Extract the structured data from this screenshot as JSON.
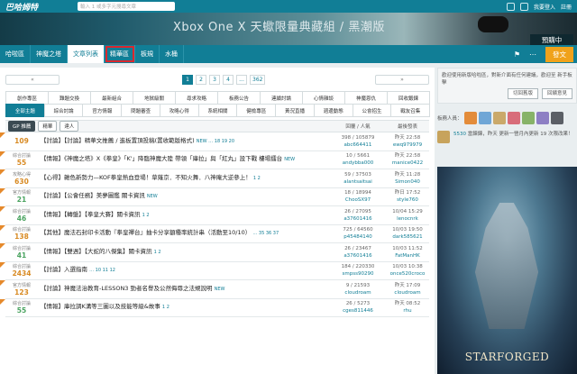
{
  "topbar": {
    "logo": "巴哈姆特",
    "search_placeholder": "輸入 1 或多字元搜尋文章",
    "user_center": "我要登入",
    "register": "註冊"
  },
  "banner": {
    "title": "Xbox One X 天蠍限量典藏組 / 黑潮版",
    "cta": "預購中"
  },
  "nav": {
    "items": [
      {
        "label": "哈啦區",
        "state": "normal"
      },
      {
        "label": "神魔之塔",
        "state": "normal"
      },
      {
        "label": "文章列表",
        "state": "active"
      },
      {
        "label": "精華區",
        "state": "boxed"
      },
      {
        "label": "板規",
        "state": "normal"
      },
      {
        "label": "水桶",
        "state": "normal"
      }
    ],
    "post_label": "發文"
  },
  "pager": {
    "prev": "«",
    "next": "»",
    "pages": [
      "1",
      "2",
      "3",
      "4",
      "...",
      "362"
    ],
    "current": "1"
  },
  "categories": [
    [
      "創作專區",
      "難題交換",
      "最新組合",
      "地獄級關",
      "尋求攻略",
      "板務公告",
      "連續討論",
      "心情雜談",
      "神魔恩仇",
      "回收鍛鍊"
    ],
    [
      "全部主題",
      "綜合討論",
      "官方情報",
      "問題審查",
      "攻略心得",
      "系統相關",
      "健檢專區",
      "黃況直播",
      "週邊動態",
      "公會招生",
      "戰友召集"
    ]
  ],
  "filter": {
    "gp": "GP 推薦",
    "tag1": "精華",
    "tag2": "達人",
    "col_reply": "回覆 / 人氣",
    "col_last": "最後發表"
  },
  "threads": [
    {
      "cat": "",
      "num": "109",
      "title": "【討論】【討論】精華文推薦 / 進板置頂投稿(置收範版格式)",
      "sub": "NEW … 18 19 20",
      "stats": "398 / 105879",
      "user": "abc664411",
      "time": "昨天 22:58",
      "last_user": "ewq979979"
    },
    {
      "cat": "綜合討論",
      "num": "55",
      "title": "【情報】《神魔之塔》X《拳皇》「K'」降臨神魔大陸 帶領「庫拉」與「紅丸」設下戰 樓場擂台",
      "sub": "NEW",
      "stats": "10 / 5661",
      "user": "andybba000",
      "time": "昨天 22:58",
      "last_user": "manice0422"
    },
    {
      "cat": "攻略心得",
      "num": "630",
      "title": "【心得】雜色新勢力—KOF拳皇熱血登場！草薙京．不知火舞．八神庵大逆參上！",
      "sub": "1 2",
      "stats": "59 / 37503",
      "user": "alantsaitsai",
      "time": "昨天 11:28",
      "last_user": "Simon040"
    },
    {
      "cat": "官方情報",
      "num": "21",
      "title": "【討論】【公會任務】美夢圖鑑 關卡資訊",
      "sub": "NEW",
      "stats": "18 / 18994",
      "user": "ChooSX97",
      "time": "昨日 17:52",
      "last_user": "style760"
    },
    {
      "cat": "綜合討論",
      "num": "46",
      "title": "【情報】【轉盤】【拳皇大賽】關卡資訊",
      "sub": "1 2",
      "stats": "26 / 27095",
      "user": "a37601416",
      "time": "10/04 15:29",
      "last_user": "lenocnrk"
    },
    {
      "cat": "綜合討論",
      "num": "138",
      "title": "【其他】魔法石封印卡活動『拳皇禪台』抽卡分享額種率統計串（活動至10/10）",
      "sub": "… 35 36 37",
      "stats": "725 / 64560",
      "user": "p45484140",
      "time": "10/03 19:50",
      "last_user": "dark585621"
    },
    {
      "cat": "綜合討論",
      "num": "41",
      "title": "【情報】【雙週】【大蛇的八傑集】關卡資訊",
      "sub": "1 2",
      "stats": "26 / 23467",
      "user": "a37601416",
      "time": "10/03 11:52",
      "last_user": "FatManHK"
    },
    {
      "cat": "綜合討論",
      "num": "2434",
      "title": "【討論】入選指南",
      "sub": "… 10 11 12",
      "stats": "184 / 220330",
      "user": "smpss90290",
      "time": "10/03 10:38",
      "last_user": "once520croco"
    },
    {
      "cat": "官方情報",
      "num": "123",
      "title": "【討論】神魔法治教育-LESSON3 勁者名譽及公然侮辱之法規說明",
      "sub": "NEW",
      "stats": "9 / 21593",
      "user": "cloudroam",
      "time": "昨天 17:09",
      "last_user": "cloudroam"
    },
    {
      "cat": "綜合討論",
      "num": "55",
      "title": "【情報】庫拉調K溝等三圖以及技能等級&故事",
      "sub": "1 2",
      "stats": "26 / 5273",
      "user": "cges811446",
      "time": "昨天 08:52",
      "last_user": "rhu"
    }
  ],
  "sidebar": {
    "notice": "歡迎使用新版哈啦區，對新介面有任何建議，歡迎至 新手板擊",
    "notice_link": "新手板擊",
    "btn_switch": "切回舊版",
    "btn_feedback": "回饋意見",
    "mods_label": "板務人員：",
    "promo_user": "5530",
    "promo_text": "當鍊鍊，昨天 更新一營月內更新 19 次限改果！"
  },
  "art": {
    "title": "STARFORGED"
  }
}
